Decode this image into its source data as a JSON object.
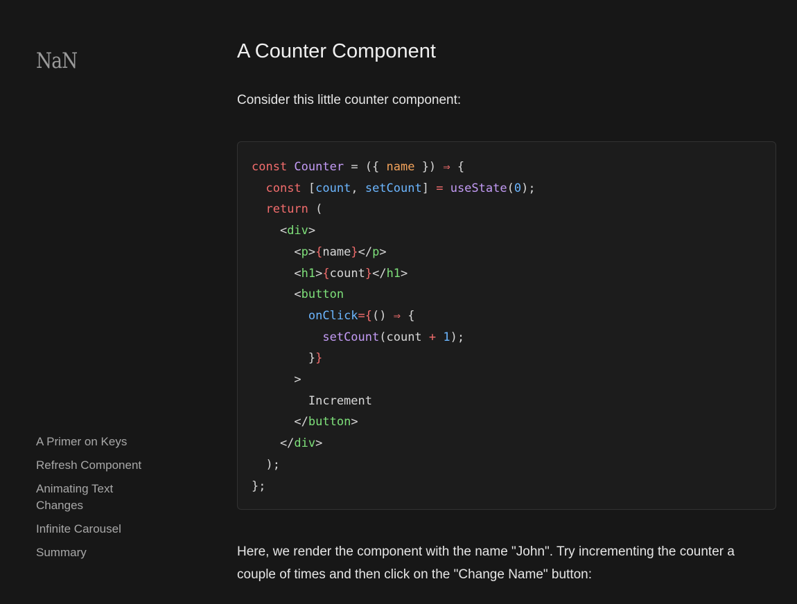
{
  "sidebar": {
    "logo": "NaN",
    "toc": [
      "A Primer on Keys",
      "Refresh Component",
      "Animating Text Changes",
      "Infinite Carousel",
      "Summary"
    ]
  },
  "article": {
    "title": "A Counter Component",
    "intro": "Consider this little counter component:",
    "followup": "Here, we render the component with the name \"John\". Try incrementing the counter a couple of times and then click on the \"Change Name\" button:",
    "code_lines": [
      [
        [
          "const ",
          "k"
        ],
        [
          "Counter",
          "f"
        ],
        [
          " = ({ ",
          "p"
        ],
        [
          "name",
          "o"
        ],
        [
          " }) ",
          "p"
        ],
        [
          "⇒",
          "k"
        ],
        [
          " {",
          "p"
        ]
      ],
      [
        [
          "  ",
          "p"
        ],
        [
          "const ",
          "k"
        ],
        [
          "[",
          "p"
        ],
        [
          "count",
          "b"
        ],
        [
          ", ",
          "p"
        ],
        [
          "setCount",
          "b"
        ],
        [
          "] ",
          "p"
        ],
        [
          "=",
          "k"
        ],
        [
          " ",
          "p"
        ],
        [
          "useState",
          "f"
        ],
        [
          "(",
          "p"
        ],
        [
          "0",
          "b"
        ],
        [
          ");",
          "p"
        ]
      ],
      [
        [
          "  ",
          "p"
        ],
        [
          "return ",
          "k"
        ],
        [
          "(",
          "p"
        ]
      ],
      [
        [
          "    <",
          "p"
        ],
        [
          "div",
          "g"
        ],
        [
          ">",
          "p"
        ]
      ],
      [
        [
          "      <",
          "p"
        ],
        [
          "p",
          "g"
        ],
        [
          ">",
          "p"
        ],
        [
          "{",
          "r"
        ],
        [
          "name",
          "p"
        ],
        [
          "}",
          "r"
        ],
        [
          "</",
          "p"
        ],
        [
          "p",
          "g"
        ],
        [
          ">",
          "p"
        ]
      ],
      [
        [
          "      <",
          "p"
        ],
        [
          "h1",
          "g"
        ],
        [
          ">",
          "p"
        ],
        [
          "{",
          "r"
        ],
        [
          "count",
          "p"
        ],
        [
          "}",
          "r"
        ],
        [
          "</",
          "p"
        ],
        [
          "h1",
          "g"
        ],
        [
          ">",
          "p"
        ]
      ],
      [
        [
          "      <",
          "p"
        ],
        [
          "button",
          "g"
        ]
      ],
      [
        [
          "        ",
          "p"
        ],
        [
          "onClick",
          "b"
        ],
        [
          "={",
          "r"
        ],
        [
          "() ",
          "p"
        ],
        [
          "⇒",
          "k"
        ],
        [
          " {",
          "p"
        ]
      ],
      [
        [
          "          ",
          "p"
        ],
        [
          "setCount",
          "f"
        ],
        [
          "(count ",
          "p"
        ],
        [
          "+",
          "k"
        ],
        [
          " ",
          "p"
        ],
        [
          "1",
          "b"
        ],
        [
          ");",
          "p"
        ]
      ],
      [
        [
          "        }",
          "p"
        ],
        [
          "}",
          "r"
        ]
      ],
      [
        [
          "      >",
          "p"
        ]
      ],
      [
        [
          "        Increment",
          "p"
        ]
      ],
      [
        [
          "      </",
          "p"
        ],
        [
          "button",
          "g"
        ],
        [
          ">",
          "p"
        ]
      ],
      [
        [
          "    </",
          "p"
        ],
        [
          "div",
          "g"
        ],
        [
          ">",
          "p"
        ]
      ],
      [
        [
          "  );",
          "p"
        ]
      ],
      [
        [
          "};",
          "p"
        ]
      ]
    ]
  }
}
